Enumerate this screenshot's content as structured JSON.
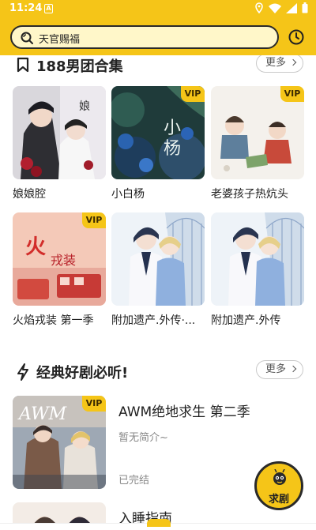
{
  "status_bar": {
    "time": "11:24",
    "app_icon_letter": "A",
    "icons": [
      "location-icon",
      "wifi-icon",
      "signal-icon",
      "battery-icon"
    ]
  },
  "search": {
    "placeholder": "天官赐福",
    "icon": "search-icon",
    "history_icon": "history-clock-icon"
  },
  "colors": {
    "brand_yellow": "#f5c518",
    "search_fill": "#fff7c9",
    "vip_badge": "#f5c518",
    "text_primary": "#222222",
    "text_secondary": "#888888"
  },
  "section1": {
    "title": "188男团合集",
    "icon": "bookmark-icon",
    "more_label": "更多",
    "items": [
      {
        "title": "娘娘腔",
        "vip": false,
        "badge": ""
      },
      {
        "title": "小白杨",
        "vip": true,
        "badge": "VIP"
      },
      {
        "title": "老婆孩子热炕头",
        "vip": true,
        "badge": "VIP"
      },
      {
        "title": "火焰戎装 第一季",
        "vip": true,
        "badge": "VIP"
      },
      {
        "title": "附加遗产.外传·...",
        "vip": false,
        "badge": ""
      },
      {
        "title": "附加遗产.外传",
        "vip": false,
        "badge": ""
      }
    ]
  },
  "section2": {
    "title": "经典好剧必听!",
    "icon": "lightning-icon",
    "more_label": "更多",
    "items": [
      {
        "title": "AWM绝地求生 第二季",
        "description": "暂无简介~",
        "status": "已完结",
        "badge": "VIP"
      },
      {
        "title": "入睡指南",
        "description": "",
        "status": "",
        "badge": ""
      }
    ]
  },
  "fab": {
    "label": "求剧",
    "icon": "bee-mascot-icon"
  }
}
